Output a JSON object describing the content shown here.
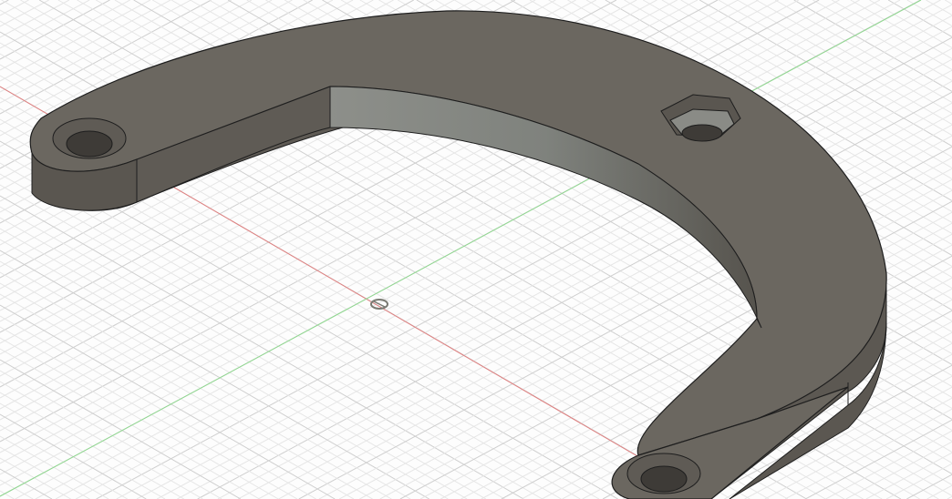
{
  "viewport": {
    "type": "3d-cad-viewport",
    "colors": {
      "background": "#fdfdfd",
      "grid_minor": "#e6e6e6",
      "grid_major": "#cfcfcf",
      "x_axis": "#e07a7a",
      "y_axis": "#8fd48f",
      "body_top": "#6e6a63",
      "body_side": "#5e5a54",
      "inner_wall": "#8a8a84",
      "edge": "#1e1e1e"
    },
    "icons": [
      "origin-icon"
    ]
  }
}
